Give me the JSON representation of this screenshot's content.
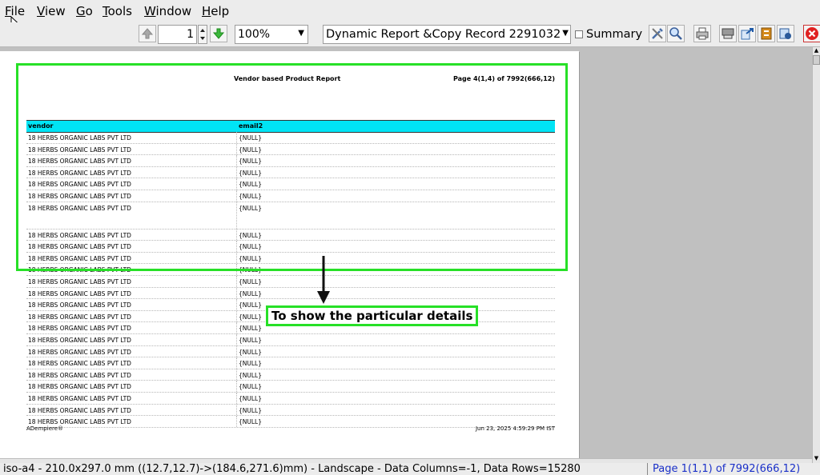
{
  "menu": {
    "file": {
      "mn": "F",
      "rest": "ile"
    },
    "view": {
      "mn": "V",
      "rest": "iew"
    },
    "go": {
      "mn": "G",
      "rest": "o"
    },
    "tools": {
      "mn": "T",
      "rest": "ools"
    },
    "window": {
      "mn": "W",
      "rest": "indow"
    },
    "help": {
      "mn": "H",
      "rest": "elp"
    }
  },
  "toolbar": {
    "page_value": "1",
    "zoom_value": "100%",
    "report_select": "Dynamic Report &Copy Record 2291032",
    "summary_label": "Summary",
    "summary_checked": false
  },
  "report": {
    "title": "Vendor based Product Report",
    "page_info": "Page 4(1,4) of 7992(666,12)",
    "columns": [
      "vendor",
      "email2"
    ],
    "rows": [
      {
        "vendor": "18 HERBS ORGANIC LABS PVT LTD",
        "email2": "{NULL}"
      },
      {
        "vendor": "18 HERBS ORGANIC LABS PVT LTD",
        "email2": "{NULL}"
      },
      {
        "vendor": "18 HERBS ORGANIC LABS PVT LTD",
        "email2": "{NULL}"
      },
      {
        "vendor": "18 HERBS ORGANIC LABS PVT LTD",
        "email2": "{NULL}"
      },
      {
        "vendor": "18 HERBS ORGANIC LABS PVT LTD",
        "email2": "{NULL}"
      },
      {
        "vendor": "18 HERBS ORGANIC LABS PVT LTD",
        "email2": "{NULL}"
      },
      {
        "vendor": "18 HERBS ORGANIC LABS PVT LTD",
        "email2": "{NULL}",
        "tall": true
      },
      {
        "vendor": "18 HERBS ORGANIC LABS PVT LTD",
        "email2": "{NULL}"
      },
      {
        "vendor": "18 HERBS ORGANIC LABS PVT LTD",
        "email2": "{NULL}"
      },
      {
        "vendor": "18 HERBS ORGANIC LABS PVT LTD",
        "email2": "{NULL}"
      },
      {
        "vendor": "18 HERBS ORGANIC LABS PVT LTD",
        "email2": "{NULL}"
      },
      {
        "vendor": "18 HERBS ORGANIC LABS PVT LTD",
        "email2": "{NULL}"
      },
      {
        "vendor": "18 HERBS ORGANIC LABS PVT LTD",
        "email2": "{NULL}"
      },
      {
        "vendor": "18 HERBS ORGANIC LABS PVT LTD",
        "email2": "{NULL}"
      },
      {
        "vendor": "18 HERBS ORGANIC LABS PVT LTD",
        "email2": "{NULL}"
      },
      {
        "vendor": "18 HERBS ORGANIC LABS PVT LTD",
        "email2": "{NULL}"
      },
      {
        "vendor": "18 HERBS ORGANIC LABS PVT LTD",
        "email2": "{NULL}"
      },
      {
        "vendor": "18 HERBS ORGANIC LABS PVT LTD",
        "email2": "{NULL}"
      },
      {
        "vendor": "18 HERBS ORGANIC LABS PVT LTD",
        "email2": "{NULL}"
      },
      {
        "vendor": "18 HERBS ORGANIC LABS PVT LTD",
        "email2": "{NULL}"
      },
      {
        "vendor": "18 HERBS ORGANIC LABS PVT LTD",
        "email2": "{NULL}"
      },
      {
        "vendor": "18 HERBS ORGANIC LABS PVT LTD",
        "email2": "{NULL}"
      },
      {
        "vendor": "18 HERBS ORGANIC LABS PVT LTD",
        "email2": "{NULL}"
      },
      {
        "vendor": "18 HERBS ORGANIC LABS PVT LTD",
        "email2": "{NULL}"
      }
    ],
    "footer_left": "ADempiere®",
    "footer_right": "Jun 23, 2025 4:59:29 PM IST"
  },
  "annotation": {
    "callout_text": "To show the particular details",
    "highlight_color": "#27e027"
  },
  "status": {
    "left": "iso-a4 - 210.0x297.0 mm ((12.7,12.7)->(184.6,271.6)mm) - Landscape - Data Columns=-1, Data Rows=15280",
    "right": "Page 1(1,1) of 7992(666,12)"
  },
  "colors": {
    "header_bg": "#00e4f5",
    "status_right": "#1a30c8"
  },
  "icons": [
    "up-arrow-icon",
    "down-arrow-icon",
    "tools-icon",
    "zoom-icon",
    "print-icon",
    "print-preview-icon",
    "export-icon",
    "archive-icon",
    "email-icon",
    "close-icon"
  ]
}
